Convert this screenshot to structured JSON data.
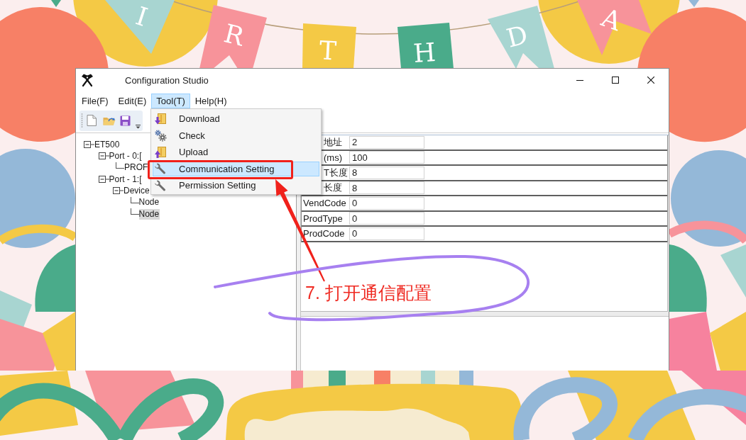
{
  "banner": {
    "letters": [
      "I",
      "R",
      "T",
      "H",
      "D",
      "A"
    ]
  },
  "window": {
    "title": "Configuration Studio"
  },
  "menu_bar": [
    {
      "label": "File(F)",
      "selected": false
    },
    {
      "label": "Edit(E)",
      "selected": false
    },
    {
      "label": "Tool(T)",
      "selected": true
    },
    {
      "label": "Help(H)",
      "selected": false
    }
  ],
  "tree": [
    {
      "label": "ET500",
      "expanded": true,
      "selected": false,
      "children": [
        {
          "label": "Port - 0:[",
          "expanded": true,
          "selected": false,
          "children": [
            {
              "label": "PROF",
              "selected": false
            }
          ]
        },
        {
          "label": "Port - 1:[",
          "expanded": true,
          "selected": false,
          "children": [
            {
              "label": "Device",
              "expanded": true,
              "selected": false,
              "children": [
                {
                  "label": "Node",
                  "selected": false
                },
                {
                  "label": "Node",
                  "selected": true
                }
              ]
            }
          ]
        }
      ]
    }
  ],
  "properties": [
    {
      "label": "地址",
      "value": "2"
    },
    {
      "label": "(ms)",
      "value": "100"
    },
    {
      "label": "T长度",
      "value": "8"
    },
    {
      "label": "长度",
      "value": "8"
    },
    {
      "label": "VendCode",
      "value": "0"
    },
    {
      "label": "ProdType",
      "value": "0"
    },
    {
      "label": "ProdCode",
      "value": "0"
    }
  ],
  "tool_menu": {
    "items": [
      {
        "label": "Download",
        "selected": false
      },
      {
        "label": "Check",
        "selected": false
      },
      {
        "label": "Upload",
        "selected": false
      },
      {
        "label": "Communication Setting",
        "selected": true
      },
      {
        "label": "Permission Setting",
        "selected": false
      }
    ]
  },
  "annotation": {
    "text": "7. 打开通信配置"
  }
}
